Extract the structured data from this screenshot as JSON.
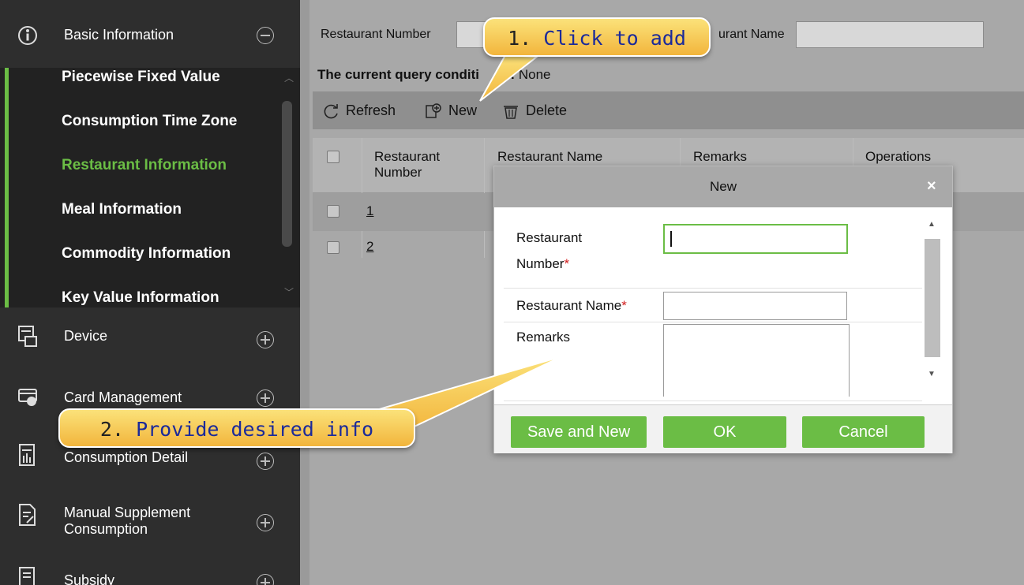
{
  "sidebar": {
    "groups": [
      {
        "label": "Basic Information",
        "icon": "info-icon",
        "toggle": "minus"
      },
      {
        "label": "Device",
        "icon": "device-icon",
        "toggle": "plus"
      },
      {
        "label": "Card Management",
        "icon": "card-icon",
        "toggle": "plus"
      },
      {
        "label": "Consumption Detail",
        "icon": "report-icon",
        "toggle": "plus"
      },
      {
        "label": "Manual Supplement Consumption",
        "icon": "document-icon",
        "toggle": "plus"
      },
      {
        "label": "Subsidy",
        "icon": "list-icon",
        "toggle": "plus"
      }
    ],
    "subitems": [
      {
        "label": "Piecewise Fixed Value",
        "active": false
      },
      {
        "label": "Consumption Time Zone",
        "active": false
      },
      {
        "label": "Restaurant Information",
        "active": true
      },
      {
        "label": "Meal Information",
        "active": false
      },
      {
        "label": "Commodity Information",
        "active": false
      },
      {
        "label": "Key Value Information",
        "active": false
      }
    ]
  },
  "query": {
    "number_label": "Restaurant Number",
    "name_label_visible": "urant Name",
    "conditions_label": "The current query conditi",
    "conditions_label_tail": "s:",
    "conditions_value": "None"
  },
  "toolbar": {
    "refresh_label": "Refresh",
    "new_label": "New",
    "delete_label": "Delete"
  },
  "table": {
    "columns": [
      "Restaurant Number",
      "Restaurant Name",
      "Remarks",
      "Operations"
    ],
    "rows": [
      {
        "number": "1"
      },
      {
        "number": "2"
      }
    ]
  },
  "dialog": {
    "title": "New",
    "close_glyph": "×",
    "fields": {
      "number_label": "Restaurant Number",
      "name_label": "Restaurant Name",
      "remarks_label": "Remarks",
      "required_mark": "*",
      "number_value": "",
      "name_value": "",
      "remarks_value": ""
    },
    "buttons": {
      "save_new": "Save and New",
      "ok": "OK",
      "cancel": "Cancel"
    }
  },
  "callouts": {
    "step1_num": "1.",
    "step1_text": "Click to add",
    "step2_num": "2.",
    "step2_text": "Provide desired info"
  },
  "colors": {
    "accent": "#6bbd45",
    "sidebar_bg": "#2e2e2e",
    "callout": "#f6c94c",
    "required": "#d21f1f"
  }
}
